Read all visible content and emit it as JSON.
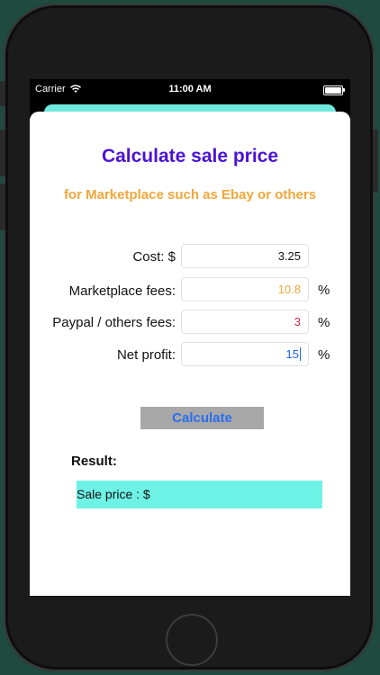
{
  "status_bar": {
    "carrier": "Carrier",
    "time": "11:00 AM"
  },
  "app": {
    "title": "Calculate sale price",
    "subtitle": "for Marketplace such as Ebay or others"
  },
  "form": {
    "cost": {
      "label": "Cost: $",
      "value": "3.25"
    },
    "marketplace_fees": {
      "label": "Marketplace fees:",
      "value": "10.8",
      "unit": "%"
    },
    "paypal_fees": {
      "label": "Paypal / others fees:",
      "value": "3",
      "unit": "%"
    },
    "net_profit": {
      "label": "Net profit:",
      "value": "15",
      "unit": "%"
    }
  },
  "calculate_label": "Calculate",
  "result": {
    "label": "Result:",
    "output": "Sale price : $"
  },
  "colors": {
    "title": "#4b13d6",
    "subtitle": "#f0a73b",
    "marketplace_value": "#f0a73b",
    "paypal_value": "#e0264e",
    "profit_value": "#1a62ff",
    "result_bg": "#6ff2e6",
    "button_bg": "#a8a8a8",
    "button_text": "#2a6ef0"
  },
  "icons": [
    "wifi-icon",
    "battery-icon"
  ]
}
